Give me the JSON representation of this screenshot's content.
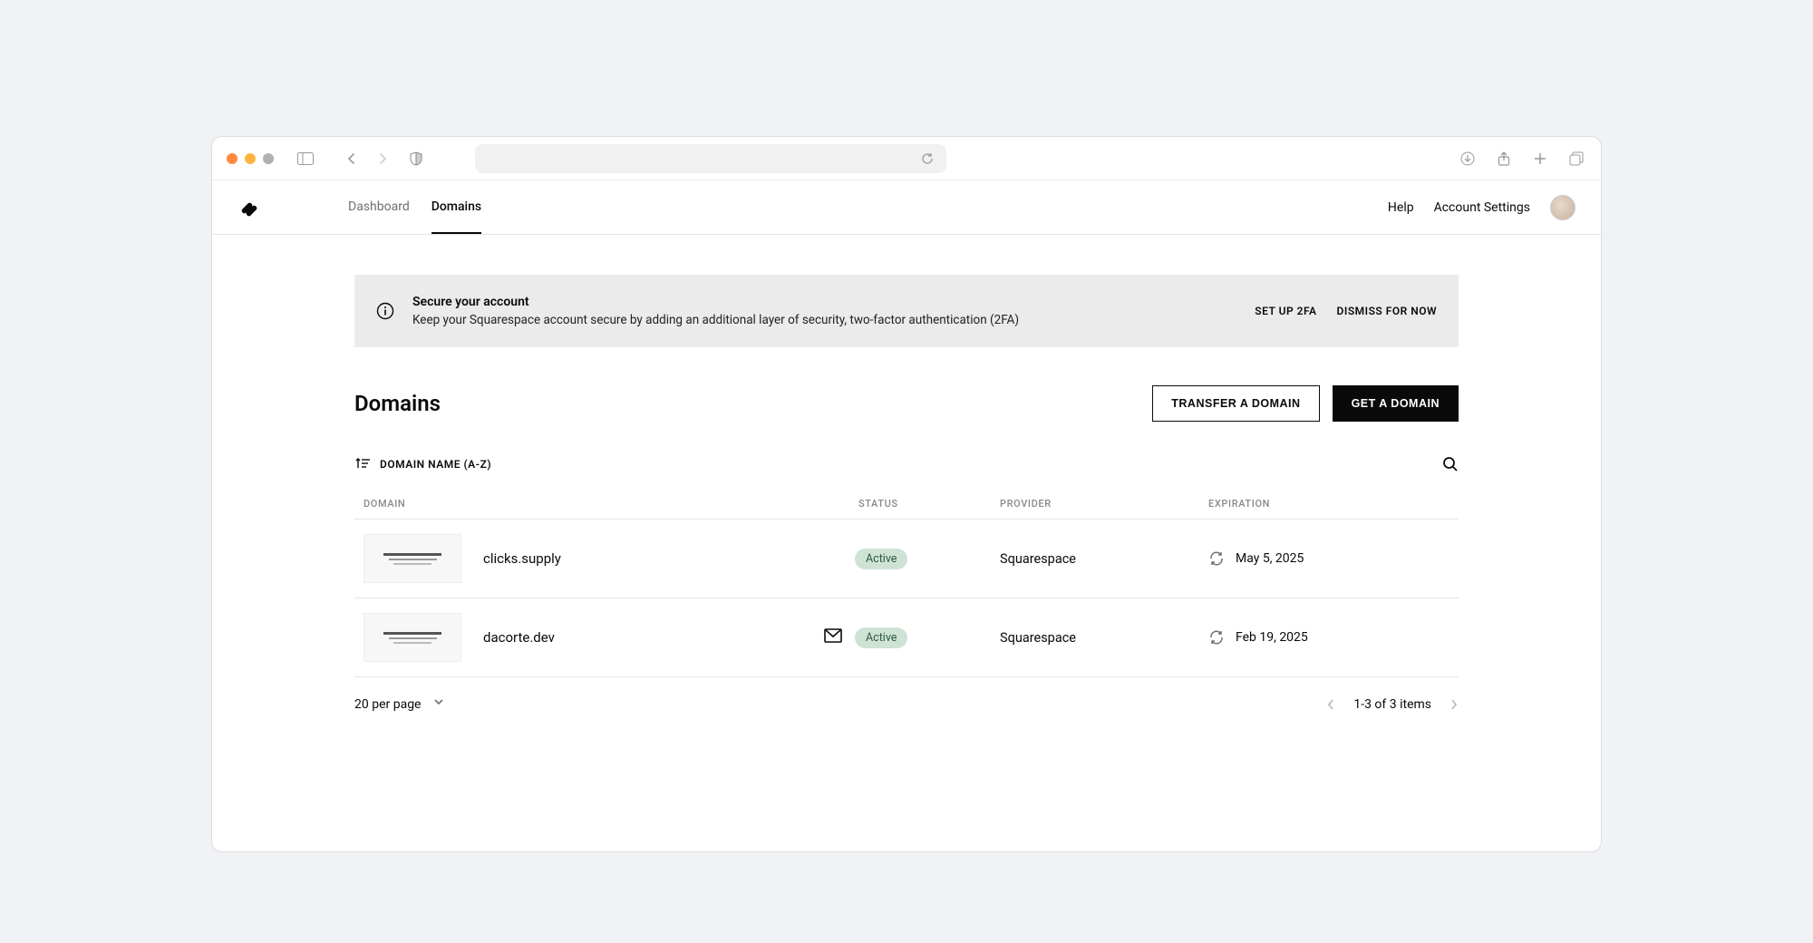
{
  "nav": {
    "dashboard": "Dashboard",
    "domains": "Domains"
  },
  "header": {
    "help": "Help",
    "account_settings": "Account Settings"
  },
  "banner": {
    "title": "Secure your account",
    "desc": "Keep your Squarespace account secure by adding an additional layer of security, two-factor authentication (2FA)",
    "setup": "SET UP 2FA",
    "dismiss": "DISMISS FOR NOW"
  },
  "page": {
    "title": "Domains",
    "transfer_btn": "TRANSFER A DOMAIN",
    "get_btn": "GET A DOMAIN"
  },
  "sort": {
    "label": "DOMAIN NAME (A-Z)"
  },
  "columns": {
    "domain": "DOMAIN",
    "status": "STATUS",
    "provider": "PROVIDER",
    "expiration": "EXPIRATION"
  },
  "rows": [
    {
      "domain": "clicks.supply",
      "status": "Active",
      "provider": "Squarespace",
      "expiration": "May 5, 2025",
      "has_mail": false
    },
    {
      "domain": "dacorte.dev",
      "status": "Active",
      "provider": "Squarespace",
      "expiration": "Feb 19, 2025",
      "has_mail": true
    }
  ],
  "pagination": {
    "per_page": "20 per page",
    "count": "1-3 of 3 items"
  }
}
